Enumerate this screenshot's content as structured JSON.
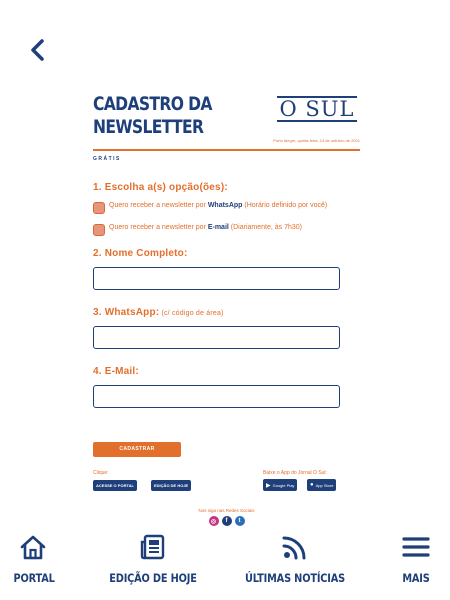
{
  "header": {
    "title_line1": "CADASTRO DA",
    "title_line2": "NEWSLETTER",
    "logo": "O SUL",
    "date": "Porto Alegre, quinta-feira, 14 de outubro de 2021",
    "gratis": "GRÁTIS"
  },
  "step1": {
    "title": "1. Escolha a(s) opção(ões):",
    "option_whatsapp": {
      "pre": "Quero receber a newsletter por ",
      "bold": "WhatsApp",
      "post": " (Horário definido por você)"
    },
    "option_email": {
      "pre": "Quero receber a newsletter por ",
      "bold": "E-mail",
      "post": " (Diariamente, às 7h30)"
    }
  },
  "step2": {
    "title": "2. Nome Completo:",
    "value": ""
  },
  "step3": {
    "title": "3. WhatsApp:",
    "hint": " (c/ código de área)",
    "value": ""
  },
  "step4": {
    "title": "4. E-Mail:",
    "value": ""
  },
  "submit_label": "CADASTRAR",
  "links": {
    "clique": "Clique:",
    "portal": "ACESSE O PORTAL",
    "edicao": "EDIÇÃO DE HOJE",
    "baixe": "Baixe o App do Jornal O Sul:",
    "google": "Google Play",
    "apple": "App Store"
  },
  "social_title": "Nos siga nas Redes Sociais",
  "social": {
    "instagram": "◎",
    "facebook": "f",
    "twitter": "t"
  },
  "tabs": {
    "portal": "PORTAL",
    "edicao": "EDIÇÃO DE HOJE",
    "ultimas": "ÚLTIMAS NOTÍCIAS",
    "mais": "MAIS"
  },
  "colors": {
    "brand_blue": "#1e3f7a",
    "accent_orange": "#e36f2d"
  }
}
